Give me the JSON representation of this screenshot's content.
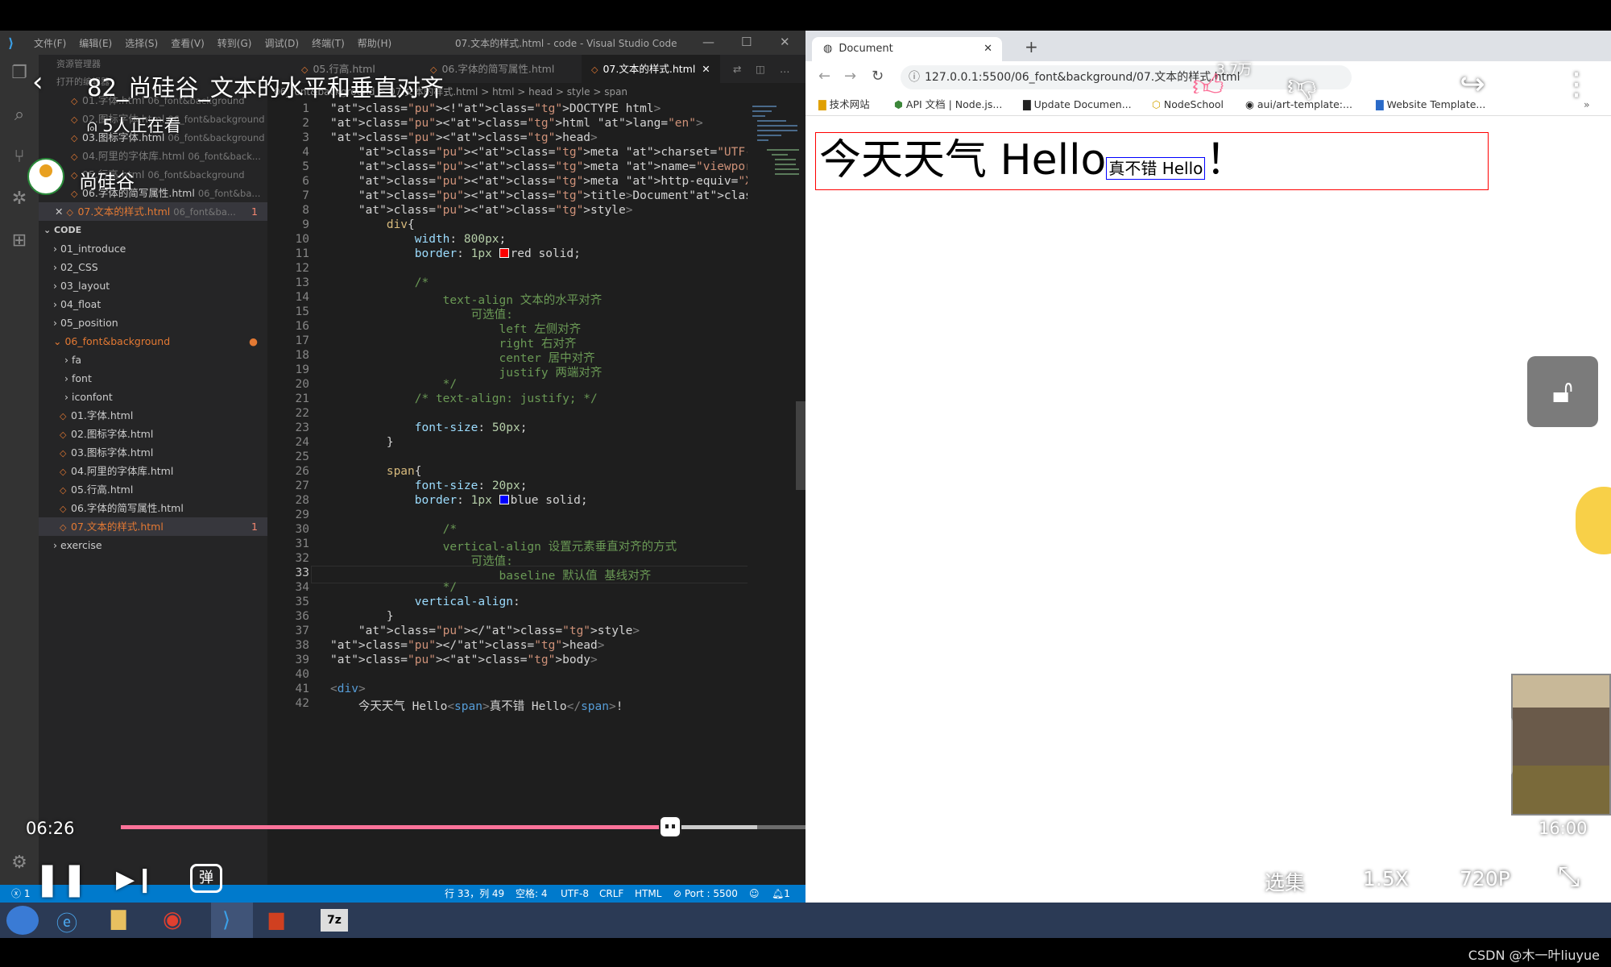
{
  "vscode": {
    "menu": [
      "文件(F)",
      "编辑(E)",
      "选择(S)",
      "查看(V)",
      "转到(G)",
      "调试(D)",
      "终端(T)",
      "帮助(H)"
    ],
    "window_title": "07.文本的样式.html - code - Visual Studio Code",
    "sidebar": {
      "explorer_title": "资源管理器",
      "open_editors_label": "打开的编辑器",
      "open_editors": [
        {
          "name": "01.字体.html",
          "hint": "06_font&background"
        },
        {
          "name": "02.图标字体.html",
          "hint": "06_font&background"
        },
        {
          "name": "03.图标字体.html",
          "hint": "06_font&background"
        },
        {
          "name": "04.阿里的字体库.html",
          "hint": "06_font&back..."
        },
        {
          "name": "05.行高.html",
          "hint": "06_font&background"
        },
        {
          "name": "06.字体的简写属性.html",
          "hint": "06_font&ba..."
        },
        {
          "name": "07.文本的样式.html",
          "hint": "06_font&ba...",
          "badge": "1"
        }
      ],
      "workspace_label": "CODE",
      "folders": [
        "01_introduce",
        "02_CSS",
        "03_layout",
        "04_float",
        "05_position",
        "06_font&background"
      ],
      "subfolders": [
        "fa",
        "font",
        "iconfont"
      ],
      "files": [
        "01.字体.html",
        "02.图标字体.html",
        "03.图标字体.html",
        "04.阿里的字体库.html",
        "05.行高.html",
        "06.字体的简写属性.html",
        "07.文本的样式.html"
      ],
      "active_file_badge": "1",
      "exercise_folder": "exercise"
    },
    "tabs": [
      "05.行高.html",
      "06.字体的简写属性.html",
      "07.文本的样式.html"
    ],
    "breadcrumb": "06_font&background > 07.文本的样式.html > html > head > style > span",
    "code_lines": [
      "<!DOCTYPE html>",
      "<html lang=\"en\">",
      "<head>",
      "<meta charset=\"UTF-8\">",
      "<meta name=\"viewport\" content=\"width=device-width, ir",
      "<meta http-equiv=\"X-UA-Compatible\" content=\"ie=edge\"",
      "<title>Document</title>",
      "<style>",
      "div{",
      "width: 800px;",
      "border: 1px red solid;",
      "",
      "/*",
      "text-align 文本的水平对齐",
      "可选值:",
      "left 左侧对齐",
      "right 右对齐",
      "center 居中对齐",
      "justify 两端对齐",
      "*/",
      "/* text-align: justify; */",
      "",
      "font-size: 50px;",
      "}",
      "",
      "span{",
      "font-size: 20px;",
      "border: 1px blue solid;",
      "",
      "/*",
      "vertical-align 设置元素垂直对齐的方式",
      "可选值:",
      "baseline 默认值 基线对齐",
      "*/",
      "vertical-align:",
      "}",
      "</style>",
      "</head>",
      "<body>",
      "",
      "<div>",
      "今天天气 Hello<span>真不错 Hello</span>!"
    ],
    "current_line": 33,
    "status": {
      "errors": "1",
      "position": "行 33，列 49",
      "spaces": "空格: 4",
      "encoding": "UTF-8",
      "eol": "CRLF",
      "language": "HTML",
      "port": "Port : 5500",
      "bell": "1"
    }
  },
  "browser": {
    "tab_title": "Document",
    "url": "127.0.0.1:5500/06_font&background/07.文本的样式.html",
    "bookmarks": [
      "技术网站",
      "API 文档 | Node.js...",
      "Update Documen...",
      "NodeSchool",
      "aui/art-template:...",
      "Website Template..."
    ],
    "page": {
      "div_text_before": "今天天气 Hello",
      "span_text": "真不错 Hello",
      "div_text_after": "！"
    }
  },
  "player": {
    "title": "82_尚硅谷_文本的水平和垂直对齐",
    "viewers": "5人正在看",
    "channel": "尚硅谷",
    "likes": "3.7万",
    "current_time": "06:26",
    "total_time": "16:00",
    "progress": 0.4037,
    "episodes_label": "选集",
    "speed_label": "1.5X",
    "quality_label": "720P",
    "danmaku_label": "弹"
  },
  "watermark": "CSDN @木一叶liuyue"
}
